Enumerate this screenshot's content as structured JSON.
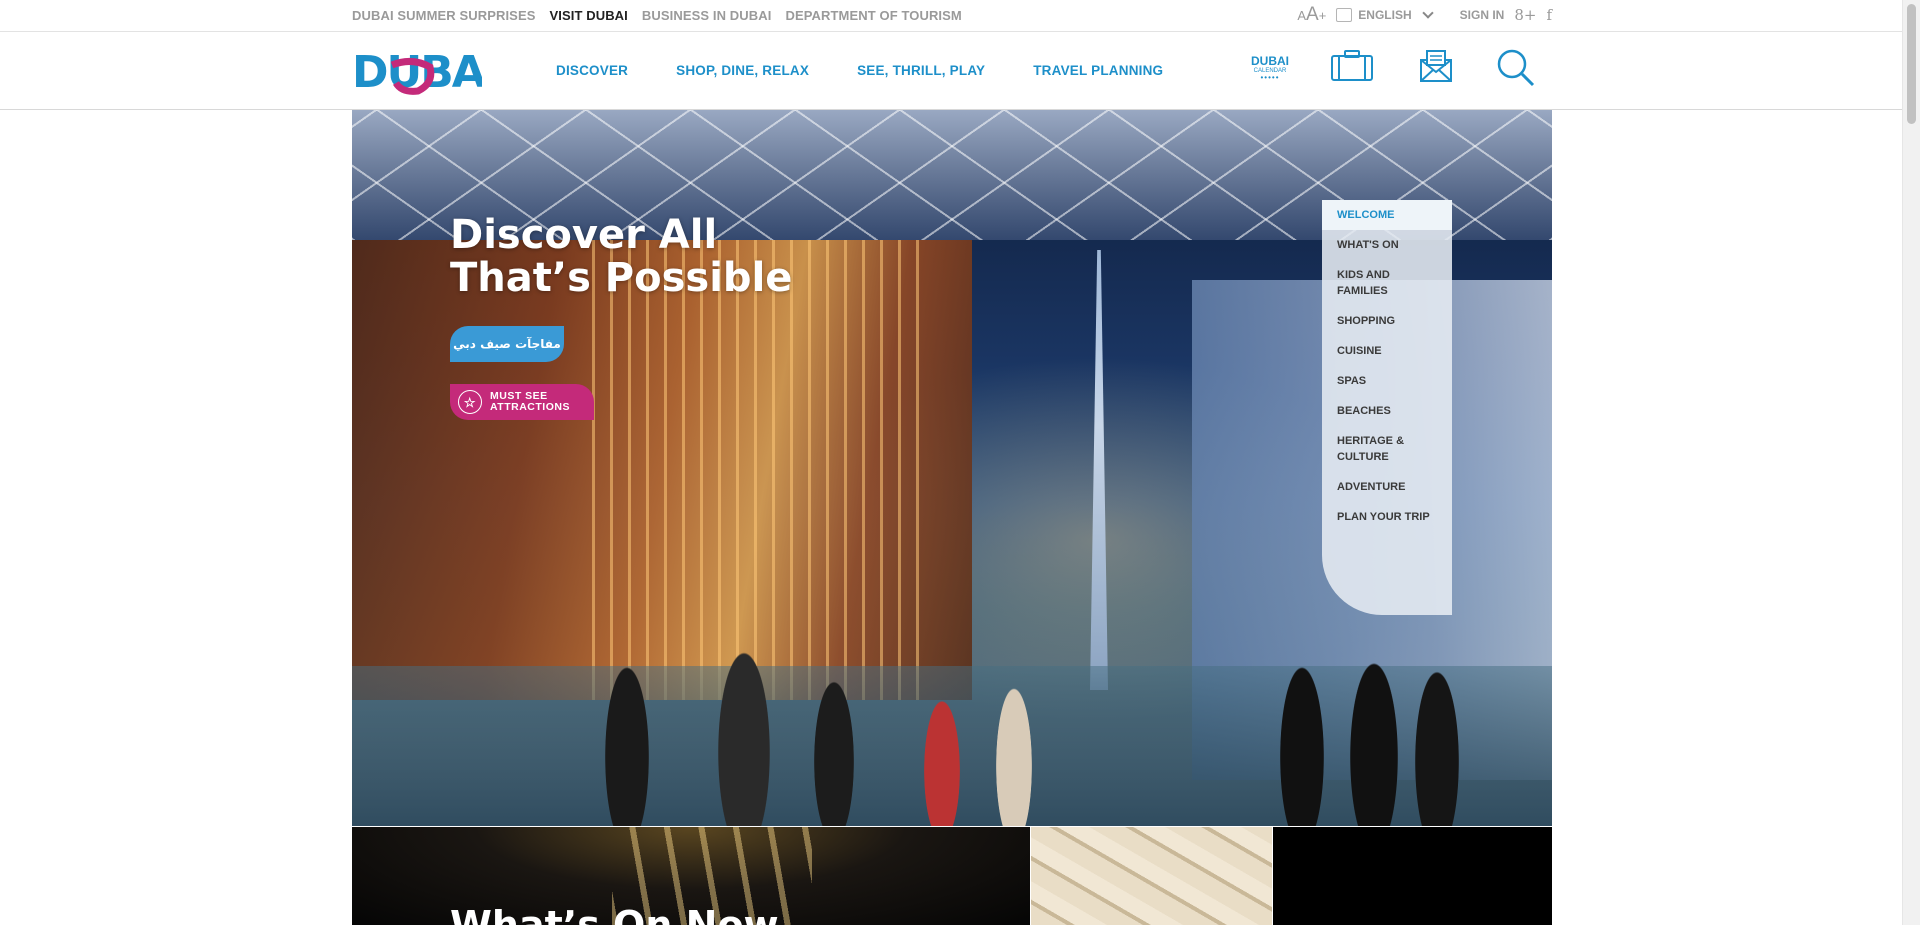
{
  "utility_bar": {
    "links": [
      "DUBAI SUMMER SURPRISES",
      "VISIT DUBAI",
      "BUSINESS IN DUBAI",
      "DEPARTMENT OF TOURISM"
    ],
    "active_link": "VISIT DUBAI",
    "font_size_label": "A",
    "font_size_large": "A",
    "font_size_plus": "+",
    "language": "ENGLISH",
    "sign_in": "SIGN IN",
    "social": [
      "8+",
      "f"
    ]
  },
  "header": {
    "logo_text": "DUBAI",
    "nav": [
      "DISCOVER",
      "SHOP, DINE, RELAX",
      "SEE, THRILL, PLAY",
      "TRAVEL PLANNING"
    ],
    "calendar": {
      "line1": "DUBAI",
      "line2": "CALENDAR",
      "dots": "•••••"
    },
    "icons": [
      "suitcase-icon",
      "newsletter-icon",
      "search-icon"
    ]
  },
  "hero": {
    "title_line1": "Discover All",
    "title_line2": "That’s Possible",
    "arabic_button": "مفاجآت صيف دبي",
    "attractions_line1": "MUST SEE",
    "attractions_line2": "ATTRACTIONS",
    "attractions_icon": "star",
    "side_menu": [
      {
        "label": "WELCOME",
        "active": true
      },
      {
        "label": "WHAT'S ON",
        "active": false
      },
      {
        "label": "KIDS AND FAMILIES",
        "active": false
      },
      {
        "label": "SHOPPING",
        "active": false
      },
      {
        "label": "CUISINE",
        "active": false
      },
      {
        "label": "SPAS",
        "active": false
      },
      {
        "label": "BEACHES",
        "active": false
      },
      {
        "label": "HERITAGE & CULTURE",
        "active": false
      },
      {
        "label": "ADVENTURE",
        "active": false
      },
      {
        "label": "PLAN YOUR TRIP",
        "active": false
      }
    ]
  },
  "teasers": {
    "whats_on_title": "What’s On Now"
  },
  "colors": {
    "brand_blue": "#1d8fc9",
    "brand_pink": "#c42a7a",
    "button_blue": "#3a9ad6"
  }
}
